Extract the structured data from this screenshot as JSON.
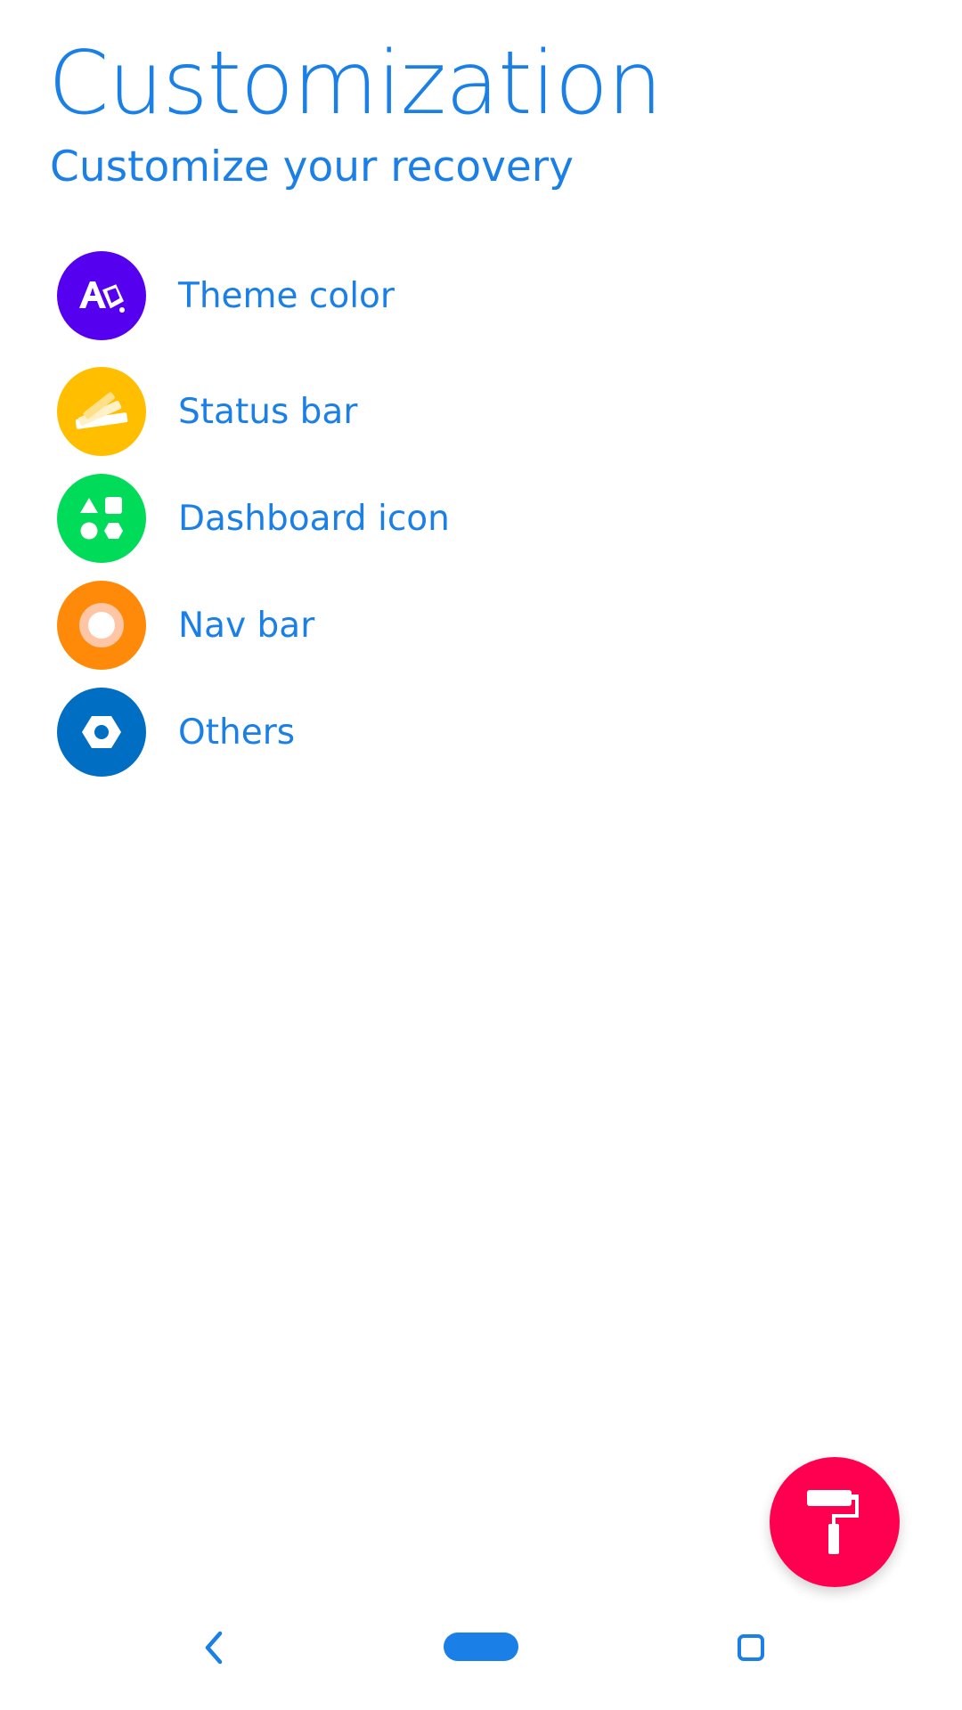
{
  "header": {
    "title": "Customization",
    "subtitle": "Customize your recovery"
  },
  "menu": {
    "items": [
      {
        "label": "Theme color",
        "icon": "theme-color-icon",
        "color": "#5600f0"
      },
      {
        "label": "Status bar",
        "icon": "status-bar-icon",
        "color": "#ffbf00"
      },
      {
        "label": "Dashboard icon",
        "icon": "dashboard-icon",
        "color": "#00db5a"
      },
      {
        "label": "Nav bar",
        "icon": "nav-bar-icon",
        "color": "#ff8a0a"
      },
      {
        "label": "Others",
        "icon": "others-icon",
        "color": "#006ec2"
      }
    ]
  },
  "fab": {
    "icon": "paint-roller-icon",
    "color": "#ff0050"
  },
  "navigation": {
    "back": "back-icon",
    "home": "home-pill-icon",
    "recents": "recents-icon",
    "color": "#1a7fe6"
  }
}
